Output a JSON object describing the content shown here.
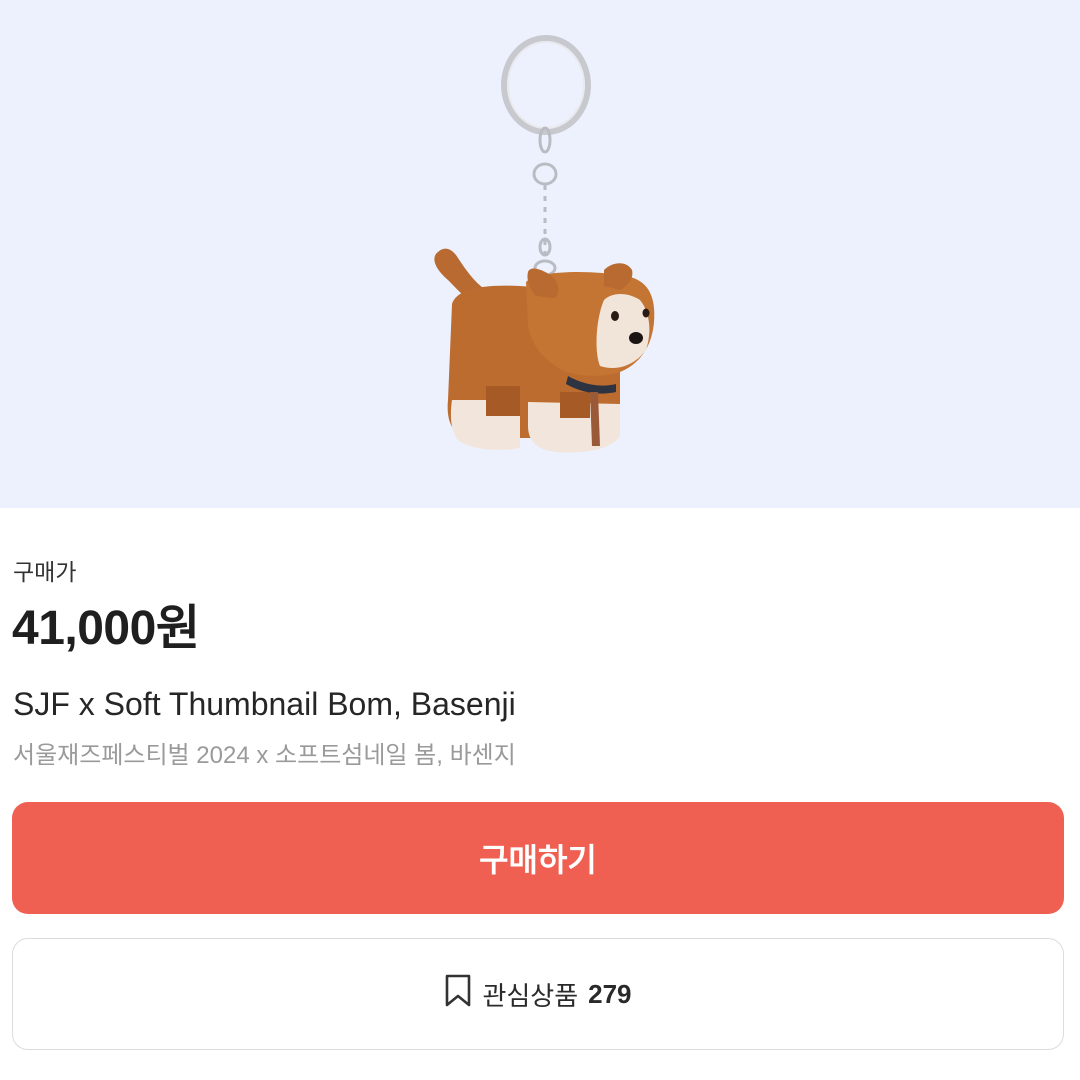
{
  "product": {
    "image_alt": "Basenji plush keychain",
    "price_label": "구매가",
    "price": "41,000원",
    "title_en": "SJF x Soft Thumbnail Bom, Basenji",
    "title_ko": "서울재즈페스티벌 2024 x 소프트섬네일 봄, 바센지"
  },
  "actions": {
    "buy_label": "구매하기",
    "wish_label": "관심상품",
    "wish_count": "279",
    "buy_color": "#ef6052"
  },
  "icons": {
    "bookmark": "bookmark-icon"
  }
}
